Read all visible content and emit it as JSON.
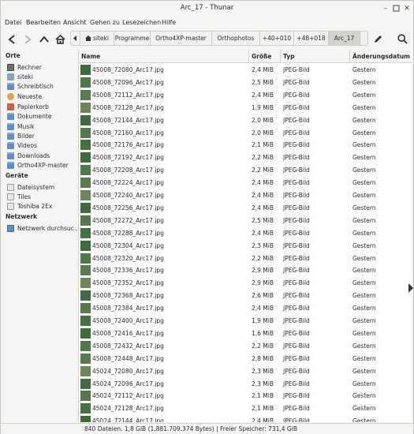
{
  "window": {
    "title": "Arc_17 - Thunar"
  },
  "menu": [
    "Datei",
    "Bearbeiten",
    "Ansicht",
    "Gehen zu",
    "Lesezeichen",
    "Hilfe"
  ],
  "breadcrumbs": [
    "siteki",
    "Programme",
    "Ortho4XP-master",
    "Orthophotos",
    "+40+010",
    "+48+018",
    "Arc_17"
  ],
  "sidebar": {
    "orte_title": "Orte",
    "orte": [
      {
        "label": "Rechner",
        "icon": "computer-icon"
      },
      {
        "label": "siteki",
        "icon": "home-icon"
      },
      {
        "label": "Schreibtisch",
        "icon": "desktop-icon"
      },
      {
        "label": "Neueste",
        "icon": "recent-icon"
      },
      {
        "label": "Papierkorb",
        "icon": "trash-icon"
      },
      {
        "label": "Dokumente",
        "icon": "folder-icon"
      },
      {
        "label": "Musik",
        "icon": "folder-icon"
      },
      {
        "label": "Bilder",
        "icon": "folder-icon"
      },
      {
        "label": "Videos",
        "icon": "folder-icon"
      },
      {
        "label": "Downloads",
        "icon": "folder-icon"
      },
      {
        "label": "Ortho4XP-master",
        "icon": "folder-icon"
      }
    ],
    "geraete_title": "Geräte",
    "geraete": [
      {
        "label": "Dateisystem",
        "icon": "drive-icon"
      },
      {
        "label": "Tiles",
        "icon": "drive-icon"
      },
      {
        "label": "Toshiba 2Ex",
        "icon": "drive-icon"
      }
    ],
    "netzwerk_title": "Netzwerk",
    "netzwerk": [
      {
        "label": "Netzwerk durchsuc...",
        "icon": "network-icon"
      }
    ]
  },
  "columns": {
    "name": "Name",
    "size": "Größe",
    "type": "Typ",
    "date": "Änderungsdatum"
  },
  "files": [
    {
      "name": "45008_72080_Arc17.jpg",
      "size": "2,4 MiB",
      "type": "JPEG-Bild",
      "date": "Gestern"
    },
    {
      "name": "45008_72096_Arc17.jpg",
      "size": "2,5 MiB",
      "type": "JPEG-Bild",
      "date": "Gestern"
    },
    {
      "name": "45008_72112_Arc17.jpg",
      "size": "2,4 MiB",
      "type": "JPEG-Bild",
      "date": "Gestern"
    },
    {
      "name": "45008_72128_Arc17.jpg",
      "size": "1,9 MiB",
      "type": "JPEG-Bild",
      "date": "Gestern"
    },
    {
      "name": "45008_72144_Arc17.jpg",
      "size": "2,0 MiB",
      "type": "JPEG-Bild",
      "date": "Gestern"
    },
    {
      "name": "45008_72160_Arc17.jpg",
      "size": "2,0 MiB",
      "type": "JPEG-Bild",
      "date": "Gestern"
    },
    {
      "name": "45008_72176_Arc17.jpg",
      "size": "2,1 MiB",
      "type": "JPEG-Bild",
      "date": "Gestern"
    },
    {
      "name": "45008_72192_Arc17.jpg",
      "size": "2,2 MiB",
      "type": "JPEG-Bild",
      "date": "Gestern"
    },
    {
      "name": "45008_72208_Arc17.jpg",
      "size": "2,2 MiB",
      "type": "JPEG-Bild",
      "date": "Gestern"
    },
    {
      "name": "45008_72224_Arc17.jpg",
      "size": "2,4 MiB",
      "type": "JPEG-Bild",
      "date": "Gestern"
    },
    {
      "name": "45008_72240_Arc17.jpg",
      "size": "2,4 MiB",
      "type": "JPEG-Bild",
      "date": "Gestern"
    },
    {
      "name": "45008_72256_Arc17.jpg",
      "size": "2,4 MiB",
      "type": "JPEG-Bild",
      "date": "Gestern"
    },
    {
      "name": "45008_72272_Arc17.jpg",
      "size": "2,5 MiB",
      "type": "JPEG-Bild",
      "date": "Gestern"
    },
    {
      "name": "45008_72288_Arc17.jpg",
      "size": "2,4 MiB",
      "type": "JPEG-Bild",
      "date": "Gestern"
    },
    {
      "name": "45008_72304_Arc17.jpg",
      "size": "2,3 MiB",
      "type": "JPEG-Bild",
      "date": "Gestern"
    },
    {
      "name": "45008_72320_Arc17.jpg",
      "size": "2,2 MiB",
      "type": "JPEG-Bild",
      "date": "Gestern"
    },
    {
      "name": "45008_72336_Arc17.jpg",
      "size": "2,9 MiB",
      "type": "JPEG-Bild",
      "date": "Gestern"
    },
    {
      "name": "45008_72352_Arc17.jpg",
      "size": "2,9 MiB",
      "type": "JPEG-Bild",
      "date": "Gestern"
    },
    {
      "name": "45008_72368_Arc17.jpg",
      "size": "2,6 MiB",
      "type": "JPEG-Bild",
      "date": "Gestern"
    },
    {
      "name": "45008_72384_Arc17.jpg",
      "size": "2,4 MiB",
      "type": "JPEG-Bild",
      "date": "Gestern"
    },
    {
      "name": "45008_72400_Arc17.jpg",
      "size": "1,9 MiB",
      "type": "JPEG-Bild",
      "date": "Gestern"
    },
    {
      "name": "45008_72416_Arc17.jpg",
      "size": "1,6 MiB",
      "type": "JPEG-Bild",
      "date": "Gestern"
    },
    {
      "name": "45008_72432_Arc17.jpg",
      "size": "2,2 MiB",
      "type": "JPEG-Bild",
      "date": "Gestern"
    },
    {
      "name": "45008_72448_Arc17.jpg",
      "size": "2,8 MiB",
      "type": "JPEG-Bild",
      "date": "Gestern"
    },
    {
      "name": "45024_72080_Arc17.jpg",
      "size": "2,3 MiB",
      "type": "JPEG-Bild",
      "date": "Gestern"
    },
    {
      "name": "45024_72096_Arc17.jpg",
      "size": "2,3 MiB",
      "type": "JPEG-Bild",
      "date": "Gestern"
    },
    {
      "name": "45024_72112_Arc17.jpg",
      "size": "2,1 MiB",
      "type": "JPEG-Bild",
      "date": "Gestern"
    },
    {
      "name": "45024_72128_Arc17.jpg",
      "size": "2,1 MiB",
      "type": "JPEG-Bild",
      "date": "Gestern"
    },
    {
      "name": "45024_72144_Arc17.jpg",
      "size": "2,4 MiB",
      "type": "JPEG-Bild",
      "date": "Gestern"
    }
  ],
  "status": "840 Dateien. 1,8 GiB (1.881.709.374 Bytes) | Freier Speicher: 731,4 GiB",
  "colors": {
    "window_bg": "#f6f5f4",
    "list_bg": "#ffffff",
    "active_crumb": "#d4d2cf"
  }
}
